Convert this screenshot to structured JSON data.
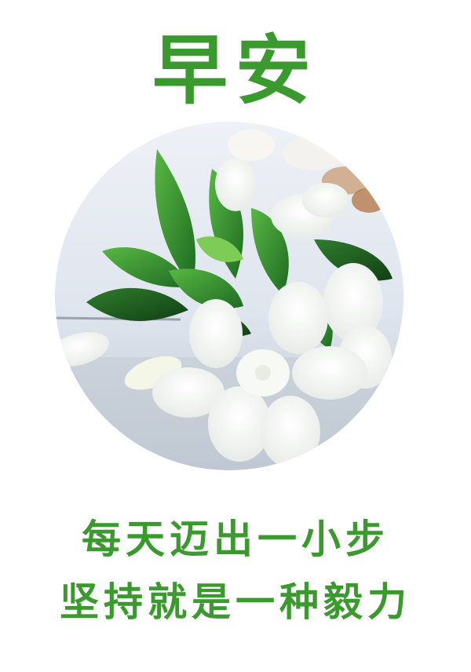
{
  "title": "早安",
  "photo": {
    "subject": "white-gardenia-bouquet"
  },
  "caption": {
    "line1": "每天迈出一小步",
    "line2": "坚持就是一种毅力"
  },
  "colors": {
    "text_green": "#3a9a2e",
    "background": "#ffffff"
  }
}
